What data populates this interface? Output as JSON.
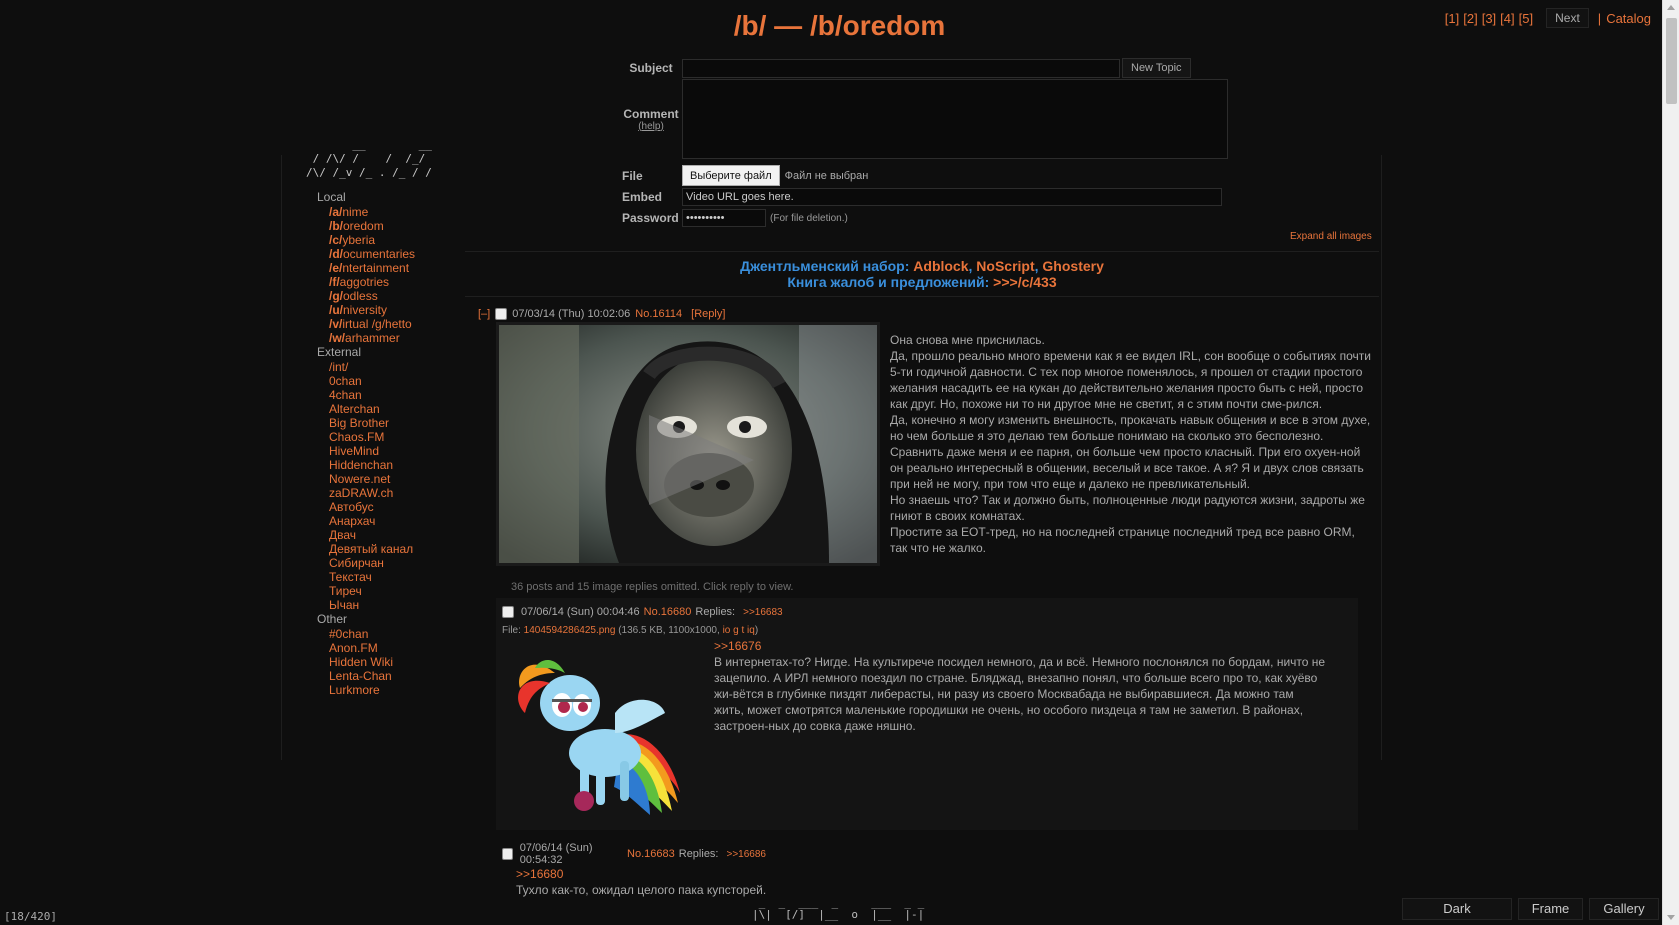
{
  "board": {
    "title": "/b/ — /b/oredom"
  },
  "pager": {
    "pages": [
      "[1]",
      "[2]",
      "[3]",
      "[4]",
      "[5]"
    ],
    "next_label": "Next",
    "sep": "|",
    "catalog_label": "Catalog"
  },
  "form": {
    "subject_label": "Subject",
    "new_topic_label": "New Topic",
    "comment_label": "Comment",
    "help_label": "(help)",
    "file_label": "File",
    "file_button": "Выберите файл",
    "file_status": "Файл не выбран",
    "embed_label": "Embed",
    "embed_value": "Video URL goes here.",
    "password_label": "Password",
    "password_value": "••••••••••",
    "password_note": "(For file deletion.)",
    "expand_all": "Expand all images"
  },
  "announcement": {
    "line1_prefix": "Джентльменский набор: ",
    "line1_links": [
      "Adblock",
      "NoScript",
      "Ghostery"
    ],
    "comma": ", ",
    "line2_prefix": "Книга жалоб и предложений: ",
    "line2_link": ">>>/c/433"
  },
  "sidebar": {
    "ascii": "       __        __\n / /\\/ /    /  /_/\n/\\/ /_v /_ . /_ / /",
    "sections": [
      {
        "title": "Local",
        "items": [
          {
            "prefix": "/a/",
            "rest": "nime"
          },
          {
            "prefix": "/b/",
            "rest": "oredom"
          },
          {
            "prefix": "/c/",
            "rest": "yberia"
          },
          {
            "prefix": "/d/",
            "rest": "ocumentaries"
          },
          {
            "prefix": "/e/",
            "rest": "ntertainment"
          },
          {
            "prefix": "/f/",
            "rest": "aggotries"
          },
          {
            "prefix": "/g/",
            "rest": "odless"
          },
          {
            "prefix": "/u/",
            "rest": "niversity"
          },
          {
            "prefix": "/v/",
            "rest": "irtual /g/hetto"
          },
          {
            "prefix": "/w/",
            "rest": "arhammer"
          }
        ]
      },
      {
        "title": "External",
        "items": [
          {
            "prefix": "",
            "rest": "/int/"
          },
          {
            "prefix": "",
            "rest": "0chan"
          },
          {
            "prefix": "",
            "rest": "4chan"
          },
          {
            "prefix": "",
            "rest": "Alterchan"
          },
          {
            "prefix": "",
            "rest": "Big Brother"
          },
          {
            "prefix": "",
            "rest": "Chaos.FM"
          },
          {
            "prefix": "",
            "rest": "HiveMind"
          },
          {
            "prefix": "",
            "rest": "Hiddenchan"
          },
          {
            "prefix": "",
            "rest": "Nowere.net"
          },
          {
            "prefix": "",
            "rest": "zaDRAW.ch"
          },
          {
            "prefix": "",
            "rest": "Автобус"
          },
          {
            "prefix": "",
            "rest": "Анархач"
          },
          {
            "prefix": "",
            "rest": "Двач"
          },
          {
            "prefix": "",
            "rest": "Девятый канал"
          },
          {
            "prefix": "",
            "rest": "Сибирчан"
          },
          {
            "prefix": "",
            "rest": "Текстач"
          },
          {
            "prefix": "",
            "rest": "Тиреч"
          },
          {
            "prefix": "",
            "rest": "Ычан"
          }
        ]
      },
      {
        "title": "Other",
        "items": [
          {
            "prefix": "",
            "rest": "#0chan"
          },
          {
            "prefix": "",
            "rest": "Anon.FM"
          },
          {
            "prefix": "",
            "rest": "Hidden Wiki"
          },
          {
            "prefix": "",
            "rest": "Lenta-Chan"
          },
          {
            "prefix": "",
            "rest": "Lurkmore"
          }
        ]
      }
    ]
  },
  "op": {
    "toggle": "[–]",
    "date": "07/03/14 (Thu) 10:02:06",
    "number": "No.16114",
    "reply_link": "[Reply]",
    "paragraphs": [
      "Она снова мне приснилась.",
      "Да,  прошло реально много времени как я ее видел IRL, сон вообще о событиях почти 5-ти годичной давности. С тех пор многое поменялось,  я прошел от стадии простого желания насадить ее на кукан до действительно желания просто быть с ней, просто как друг.  Но, похоже ни то ни другое мне не светит, я с этим почти сме-рился.",
      "Да, конечно я могу изменить внешность, прокачать навык общения и все в этом духе, но чем больше я это делаю тем больше понимаю на сколько это бесполезно. Сравнить даже меня и ее парня, он больше чем просто класный.  При его охуен-ной он реально интересный в общении, веселый и все такое. А я? Я и двух слов связать при ней не могу,  при том что еще и далеко не превликательный.",
      "Но знаешь что? Так и должно быть, полноценные люди радуются жизни, задроты же гниют в своих комнатах.",
      "Простите за ЕОТ-тред, но на последней странице последний тред все равно ORM, так что не жалко."
    ],
    "omitted": "36 posts and 15 image replies omitted. Click reply to view."
  },
  "replies": [
    {
      "date": "07/06/14 (Sun) 00:04:46",
      "number": "No.16680",
      "replies_label": "Replies:",
      "replies_links": ">>16683",
      "file_prefix": "File: ",
      "file_name": "1404594286425.png",
      "file_meta": " (136.5 KB, 1100x1000, ",
      "file_tools": "io g t iq",
      "file_close": ")",
      "quote": ">>16676",
      "text": "В интернетах-то? Нигде. На культирече посидел немного, да и всё. Немного послонялся по бордам, ничто не зацепило. А ИРЛ немного поездил по стране. Бляджад, внезапно понял, что больше всего про то, как хуёво жи-вётся в глубинке пиздят либерасты, ни разу из своего Москвабада не выбиравшиеся. Да можно там жить, может смотрятся маленькие городишки не очень, но особого пиздеца я там не заметил. В районах, застроен-ных до совка даже няшно."
    },
    {
      "date": "07/06/14 (Sun) 00:54:32",
      "number": "No.16683",
      "replies_label": "Replies:",
      "replies_links": ">>16686",
      "quote": ">>16680",
      "text": "Тухло как-то, ожидал целого пака купсторей."
    }
  ],
  "footer": {
    "counter": "[18/420]",
    "ascii": " _  _  ___  _     ___  _ _\n|\\|  [/]  |__  o  |__  |-|",
    "styles": [
      "Dark",
      "Frame",
      "Gallery"
    ]
  }
}
